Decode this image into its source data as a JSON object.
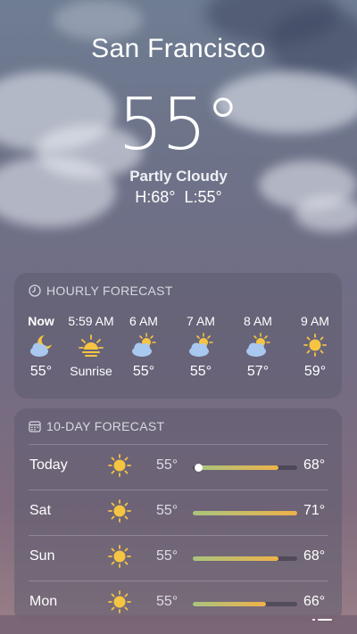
{
  "location": {
    "city": "San Francisco"
  },
  "current": {
    "temp": "55°",
    "condition": "Partly Cloudy",
    "high": "H:68°",
    "low": "L:55°"
  },
  "hourly": {
    "title": "HOURLY FORECAST",
    "items": [
      {
        "time": "Now",
        "icon": "partly-cloudy-night-icon",
        "value": "55°"
      },
      {
        "time": "5:59 AM",
        "icon": "sunrise-icon",
        "value": "Sunrise"
      },
      {
        "time": "6 AM",
        "icon": "partly-cloudy-icon",
        "value": "55°"
      },
      {
        "time": "7 AM",
        "icon": "partly-cloudy-icon",
        "value": "55°"
      },
      {
        "time": "8 AM",
        "icon": "partly-cloudy-icon",
        "value": "57°"
      },
      {
        "time": "9 AM",
        "icon": "sun-icon",
        "value": "59°"
      }
    ]
  },
  "daily": {
    "title": "10-DAY FORECAST",
    "items": [
      {
        "day": "Today",
        "icon": "sun-icon",
        "low": "55°",
        "high": "68°",
        "range_start": 0.05,
        "range_end": 0.82,
        "current_marker": 0.05
      },
      {
        "day": "Sat",
        "icon": "sun-icon",
        "low": "55°",
        "high": "71°",
        "range_start": 0.0,
        "range_end": 1.0
      },
      {
        "day": "Sun",
        "icon": "sun-icon",
        "low": "55°",
        "high": "68°",
        "range_start": 0.0,
        "range_end": 0.82
      },
      {
        "day": "Mon",
        "icon": "sun-icon",
        "low": "55°",
        "high": "66°",
        "range_start": 0.0,
        "range_end": 0.7
      }
    ]
  },
  "colors": {
    "sun": "#f5c542",
    "cloud": "#a9c8f0",
    "range_low": "#a9c47e",
    "range_high": "#efb24a"
  }
}
